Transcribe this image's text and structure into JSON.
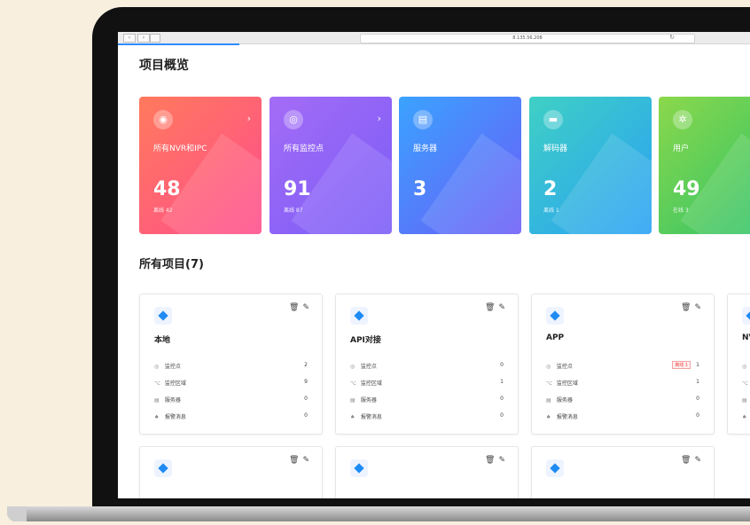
{
  "browser": {
    "url": "8.135.56.208",
    "back": "‹",
    "forward": "›",
    "reload": "↻"
  },
  "overview": {
    "title": "项目概览",
    "cards": [
      {
        "label": "所有NVR和IPC",
        "value": "48",
        "sub": "离线 42",
        "icon": "camera-icon",
        "arrow": "›",
        "color_from": "#ff7a5c",
        "color_to": "#ff4d8d"
      },
      {
        "label": "所有监控点",
        "value": "91",
        "sub": "离线 87",
        "icon": "location-icon",
        "arrow": "›",
        "color_from": "#a46cf6",
        "color_to": "#7a5cf7"
      },
      {
        "label": "服务器",
        "value": "3",
        "sub": "",
        "icon": "server-icon",
        "arrow": "",
        "color_from": "#3aa3ff",
        "color_to": "#6b5cf7"
      },
      {
        "label": "解码器",
        "value": "2",
        "sub": "离线 1",
        "icon": "decoder-icon",
        "arrow": "",
        "color_from": "#3fd0c4",
        "color_to": "#2aa0f5"
      },
      {
        "label": "用户",
        "value": "49",
        "sub": "在线 3",
        "icon": "users-icon",
        "arrow": "",
        "color_from": "#8bd84b",
        "color_to": "#2cc26a"
      }
    ]
  },
  "projects": {
    "title": "所有项目(7)",
    "row_labels": [
      "监控点",
      "监控区域",
      "服务器",
      "报警消息"
    ],
    "items": [
      {
        "name": "本地",
        "values": [
          "2",
          "9",
          "0",
          "0"
        ],
        "badge": ""
      },
      {
        "name": "API对接",
        "values": [
          "0",
          "1",
          "0",
          "0"
        ],
        "badge": ""
      },
      {
        "name": "APP",
        "values": [
          "1",
          "1",
          "0",
          "0"
        ],
        "badge": "离线 1"
      },
      {
        "name": "NV",
        "values": [
          "",
          "",
          "",
          ""
        ],
        "badge": ""
      }
    ]
  }
}
